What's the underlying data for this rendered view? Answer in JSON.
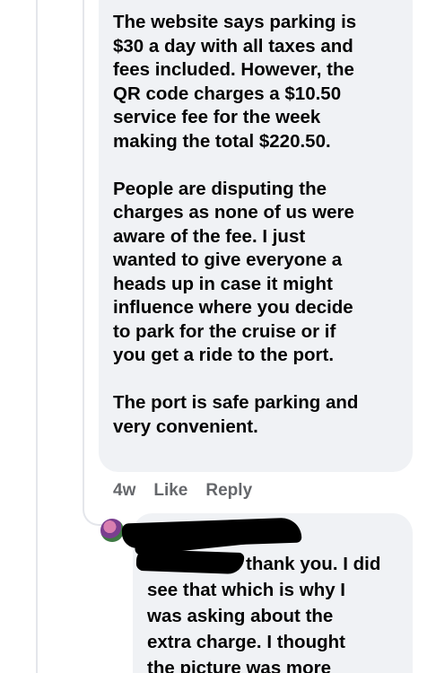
{
  "comment": {
    "paragraphs": [
      "The website says parking is\n$30 a day with all taxes and\nfees included. However, the\nQR code charges a $10.50\nservice fee for the week\nmaking the total $220.50.",
      "People are disputing the\ncharges as none of us were\naware of the fee. I just\nwanted to give everyone a\nheads up in case it might\ninfluence where you decide\nto park for the cruise or if\nyou get a ride to the port.",
      "The port is safe parking and\nvery convenient."
    ],
    "age": "4w",
    "like_label": "Like",
    "reply_label": "Reply"
  },
  "reply": {
    "first_line": "thank you. I did",
    "rest": "see that which is why I\nwas asking about the\nextra charge. I thought\nthe picture was more"
  },
  "colors": {
    "bubble": "#f0f2f5",
    "action_text": "#65676b",
    "redaction": "#000000"
  },
  "icons": {
    "avatar": "avatar-image"
  }
}
